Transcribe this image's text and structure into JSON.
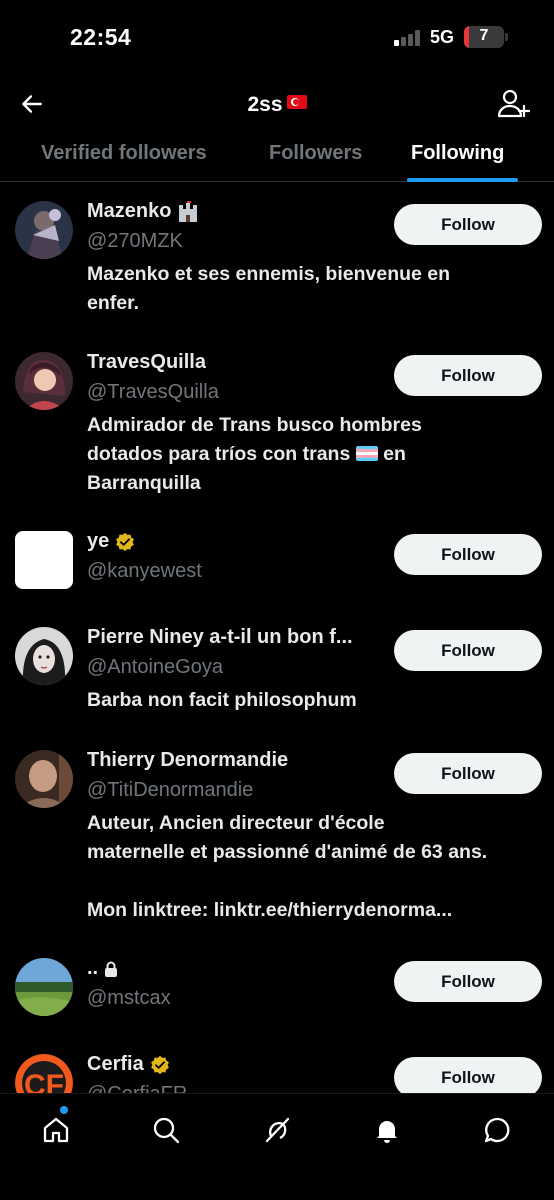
{
  "status_bar": {
    "time": "22:54",
    "network": "5G",
    "battery": "7"
  },
  "header": {
    "title": "2ss"
  },
  "tabs": [
    {
      "label": "Verified followers",
      "active": false
    },
    {
      "label": "Followers",
      "active": false
    },
    {
      "label": "Following",
      "active": true
    }
  ],
  "accent_color": "#1d9bf0",
  "users": [
    {
      "name": "Mazenko",
      "handle": "@270MZK",
      "bio": "Mazenko et ses ennemis, bienvenue en\nenfer.",
      "badge": "castle-emoji-icon",
      "button": "Follow"
    },
    {
      "name": "TravesQuilla",
      "handle": "@TravesQuilla",
      "bio_pre": "Admirador de Trans busco hombres\ndotados para tríos con trans ",
      "bio_post": " en\nBarranquilla",
      "button": "Follow"
    },
    {
      "name": "ye",
      "handle": "@kanyewest",
      "badge": "verified-icon",
      "button": "Follow"
    },
    {
      "name": "Pierre Niney a-t-il un bon f...",
      "handle": "@AntoineGoya",
      "bio": "Barba non facit philosophum",
      "button": "Follow"
    },
    {
      "name": "Thierry Denormandie",
      "handle": "@TitiDenormandie",
      "bio": "Auteur, Ancien directeur d'école\nmaternelle et passionné d'animé de 63 ans.\n\nMon linktree: linktr.ee/thierrydenorma...",
      "button": "Follow"
    },
    {
      "name": "..",
      "handle": "@mstcax",
      "badge": "lock-icon",
      "button": "Follow"
    },
    {
      "name": "Cerfia",
      "handle": "@CerfiaFR",
      "badge": "verified-icon",
      "button": "Follow"
    }
  ]
}
